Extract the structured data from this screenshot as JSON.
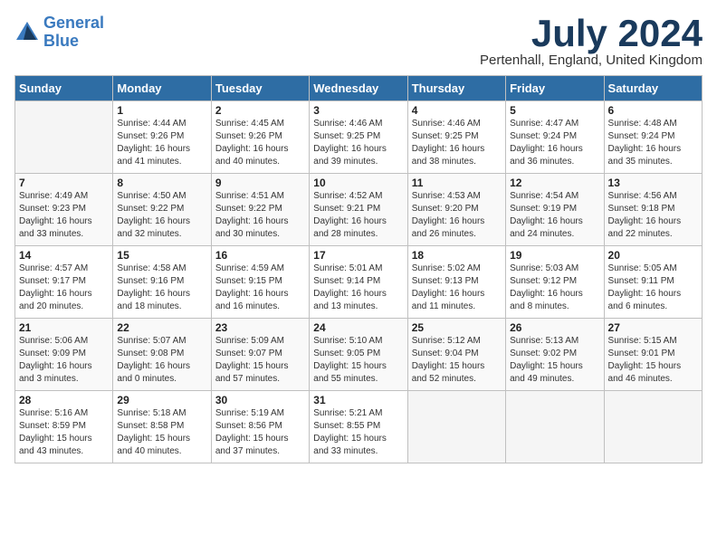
{
  "header": {
    "logo_line1": "General",
    "logo_line2": "Blue",
    "month": "July 2024",
    "location": "Pertenhall, England, United Kingdom"
  },
  "days_of_week": [
    "Sunday",
    "Monday",
    "Tuesday",
    "Wednesday",
    "Thursday",
    "Friday",
    "Saturday"
  ],
  "weeks": [
    [
      {
        "day": "",
        "sunrise": "",
        "sunset": "",
        "daylight": ""
      },
      {
        "day": "1",
        "sunrise": "Sunrise: 4:44 AM",
        "sunset": "Sunset: 9:26 PM",
        "daylight": "Daylight: 16 hours and 41 minutes."
      },
      {
        "day": "2",
        "sunrise": "Sunrise: 4:45 AM",
        "sunset": "Sunset: 9:26 PM",
        "daylight": "Daylight: 16 hours and 40 minutes."
      },
      {
        "day": "3",
        "sunrise": "Sunrise: 4:46 AM",
        "sunset": "Sunset: 9:25 PM",
        "daylight": "Daylight: 16 hours and 39 minutes."
      },
      {
        "day": "4",
        "sunrise": "Sunrise: 4:46 AM",
        "sunset": "Sunset: 9:25 PM",
        "daylight": "Daylight: 16 hours and 38 minutes."
      },
      {
        "day": "5",
        "sunrise": "Sunrise: 4:47 AM",
        "sunset": "Sunset: 9:24 PM",
        "daylight": "Daylight: 16 hours and 36 minutes."
      },
      {
        "day": "6",
        "sunrise": "Sunrise: 4:48 AM",
        "sunset": "Sunset: 9:24 PM",
        "daylight": "Daylight: 16 hours and 35 minutes."
      }
    ],
    [
      {
        "day": "7",
        "sunrise": "Sunrise: 4:49 AM",
        "sunset": "Sunset: 9:23 PM",
        "daylight": "Daylight: 16 hours and 33 minutes."
      },
      {
        "day": "8",
        "sunrise": "Sunrise: 4:50 AM",
        "sunset": "Sunset: 9:22 PM",
        "daylight": "Daylight: 16 hours and 32 minutes."
      },
      {
        "day": "9",
        "sunrise": "Sunrise: 4:51 AM",
        "sunset": "Sunset: 9:22 PM",
        "daylight": "Daylight: 16 hours and 30 minutes."
      },
      {
        "day": "10",
        "sunrise": "Sunrise: 4:52 AM",
        "sunset": "Sunset: 9:21 PM",
        "daylight": "Daylight: 16 hours and 28 minutes."
      },
      {
        "day": "11",
        "sunrise": "Sunrise: 4:53 AM",
        "sunset": "Sunset: 9:20 PM",
        "daylight": "Daylight: 16 hours and 26 minutes."
      },
      {
        "day": "12",
        "sunrise": "Sunrise: 4:54 AM",
        "sunset": "Sunset: 9:19 PM",
        "daylight": "Daylight: 16 hours and 24 minutes."
      },
      {
        "day": "13",
        "sunrise": "Sunrise: 4:56 AM",
        "sunset": "Sunset: 9:18 PM",
        "daylight": "Daylight: 16 hours and 22 minutes."
      }
    ],
    [
      {
        "day": "14",
        "sunrise": "Sunrise: 4:57 AM",
        "sunset": "Sunset: 9:17 PM",
        "daylight": "Daylight: 16 hours and 20 minutes."
      },
      {
        "day": "15",
        "sunrise": "Sunrise: 4:58 AM",
        "sunset": "Sunset: 9:16 PM",
        "daylight": "Daylight: 16 hours and 18 minutes."
      },
      {
        "day": "16",
        "sunrise": "Sunrise: 4:59 AM",
        "sunset": "Sunset: 9:15 PM",
        "daylight": "Daylight: 16 hours and 16 minutes."
      },
      {
        "day": "17",
        "sunrise": "Sunrise: 5:01 AM",
        "sunset": "Sunset: 9:14 PM",
        "daylight": "Daylight: 16 hours and 13 minutes."
      },
      {
        "day": "18",
        "sunrise": "Sunrise: 5:02 AM",
        "sunset": "Sunset: 9:13 PM",
        "daylight": "Daylight: 16 hours and 11 minutes."
      },
      {
        "day": "19",
        "sunrise": "Sunrise: 5:03 AM",
        "sunset": "Sunset: 9:12 PM",
        "daylight": "Daylight: 16 hours and 8 minutes."
      },
      {
        "day": "20",
        "sunrise": "Sunrise: 5:05 AM",
        "sunset": "Sunset: 9:11 PM",
        "daylight": "Daylight: 16 hours and 6 minutes."
      }
    ],
    [
      {
        "day": "21",
        "sunrise": "Sunrise: 5:06 AM",
        "sunset": "Sunset: 9:09 PM",
        "daylight": "Daylight: 16 hours and 3 minutes."
      },
      {
        "day": "22",
        "sunrise": "Sunrise: 5:07 AM",
        "sunset": "Sunset: 9:08 PM",
        "daylight": "Daylight: 16 hours and 0 minutes."
      },
      {
        "day": "23",
        "sunrise": "Sunrise: 5:09 AM",
        "sunset": "Sunset: 9:07 PM",
        "daylight": "Daylight: 15 hours and 57 minutes."
      },
      {
        "day": "24",
        "sunrise": "Sunrise: 5:10 AM",
        "sunset": "Sunset: 9:05 PM",
        "daylight": "Daylight: 15 hours and 55 minutes."
      },
      {
        "day": "25",
        "sunrise": "Sunrise: 5:12 AM",
        "sunset": "Sunset: 9:04 PM",
        "daylight": "Daylight: 15 hours and 52 minutes."
      },
      {
        "day": "26",
        "sunrise": "Sunrise: 5:13 AM",
        "sunset": "Sunset: 9:02 PM",
        "daylight": "Daylight: 15 hours and 49 minutes."
      },
      {
        "day": "27",
        "sunrise": "Sunrise: 5:15 AM",
        "sunset": "Sunset: 9:01 PM",
        "daylight": "Daylight: 15 hours and 46 minutes."
      }
    ],
    [
      {
        "day": "28",
        "sunrise": "Sunrise: 5:16 AM",
        "sunset": "Sunset: 8:59 PM",
        "daylight": "Daylight: 15 hours and 43 minutes."
      },
      {
        "day": "29",
        "sunrise": "Sunrise: 5:18 AM",
        "sunset": "Sunset: 8:58 PM",
        "daylight": "Daylight: 15 hours and 40 minutes."
      },
      {
        "day": "30",
        "sunrise": "Sunrise: 5:19 AM",
        "sunset": "Sunset: 8:56 PM",
        "daylight": "Daylight: 15 hours and 37 minutes."
      },
      {
        "day": "31",
        "sunrise": "Sunrise: 5:21 AM",
        "sunset": "Sunset: 8:55 PM",
        "daylight": "Daylight: 15 hours and 33 minutes."
      },
      {
        "day": "",
        "sunrise": "",
        "sunset": "",
        "daylight": ""
      },
      {
        "day": "",
        "sunrise": "",
        "sunset": "",
        "daylight": ""
      },
      {
        "day": "",
        "sunrise": "",
        "sunset": "",
        "daylight": ""
      }
    ]
  ]
}
